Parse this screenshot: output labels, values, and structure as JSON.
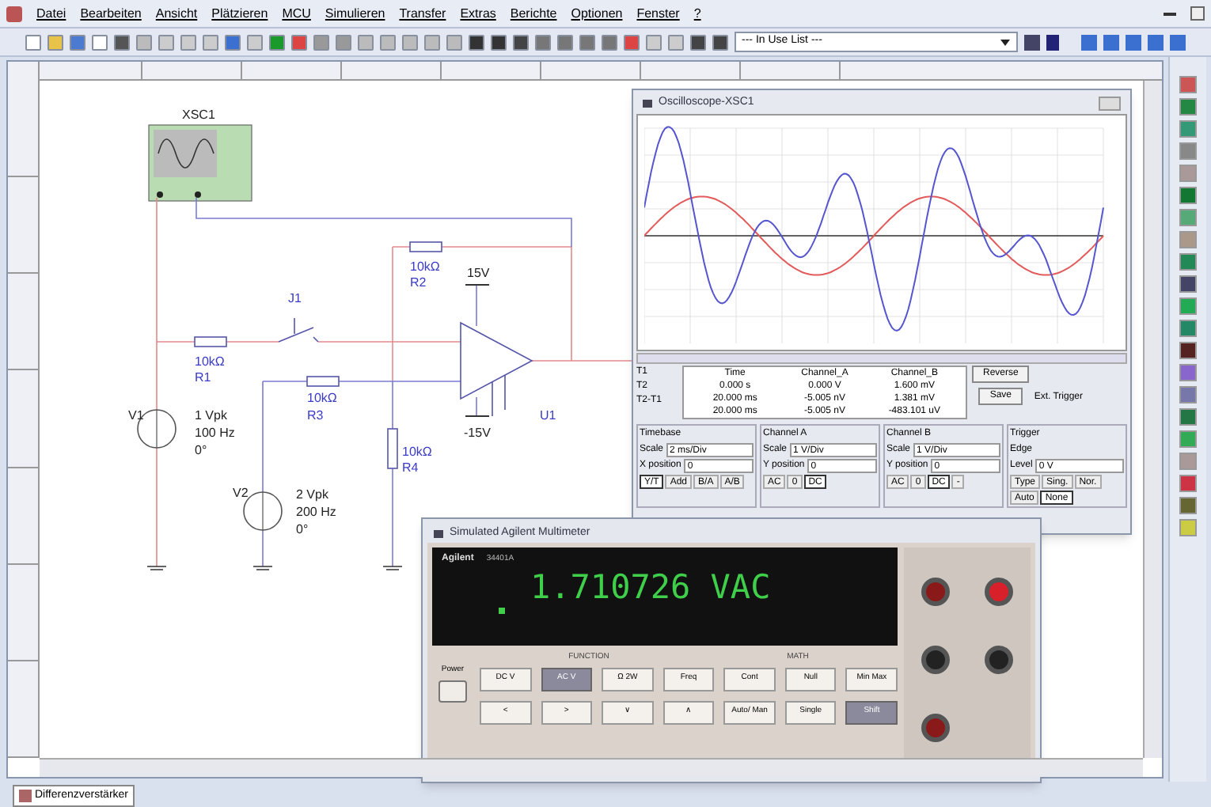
{
  "menu": [
    "Datei",
    "Bearbeiten",
    "Ansicht",
    "Plätzieren",
    "MCU",
    "Simulieren",
    "Transfer",
    "Extras",
    "Berichte",
    "Optionen",
    "Fenster",
    "?"
  ],
  "toolbar": {
    "in_use_list": "--- In Use List ---"
  },
  "schematic": {
    "labels": [
      {
        "text": "XSC1",
        "kind": "part"
      },
      {
        "text": "10kΩ",
        "kind": "ref"
      },
      {
        "text": "15V",
        "kind": "part"
      },
      {
        "text": "R2",
        "kind": "ref"
      },
      {
        "text": "J1",
        "kind": "ref"
      },
      {
        "text": "10kΩ",
        "kind": "ref"
      },
      {
        "text": "R1",
        "kind": "ref"
      },
      {
        "text": "10kΩ",
        "kind": "ref"
      },
      {
        "text": "V1",
        "kind": "part"
      },
      {
        "text": "1 Vpk",
        "kind": "part"
      },
      {
        "text": "R3",
        "kind": "ref"
      },
      {
        "text": "U1",
        "kind": "ref"
      },
      {
        "text": "100 Hz",
        "kind": "part"
      },
      {
        "text": "-15V",
        "kind": "part"
      },
      {
        "text": "0°",
        "kind": "part"
      },
      {
        "text": "10kΩ",
        "kind": "ref"
      },
      {
        "text": "R4",
        "kind": "ref"
      },
      {
        "text": "V2",
        "kind": "part"
      },
      {
        "text": "2 Vpk",
        "kind": "part"
      },
      {
        "text": "200 Hz",
        "kind": "part"
      },
      {
        "text": "0°",
        "kind": "part"
      }
    ]
  },
  "oscilloscope": {
    "title": "Oscilloscope-XSC1",
    "readout": {
      "columns": [
        "Time",
        "Channel_A",
        "Channel_B"
      ],
      "rows": [
        {
          "label": "T1",
          "values": [
            "0.000 s",
            "0.000 V",
            "1.600 mV"
          ]
        },
        {
          "label": "T2",
          "values": [
            "20.000 ms",
            "-5.005 nV",
            "1.381 mV"
          ]
        },
        {
          "label": "T2-T1",
          "values": [
            "20.000 ms",
            "-5.005 nV",
            "-483.101 uV"
          ]
        }
      ]
    },
    "buttons": [
      "Reverse",
      "Save"
    ],
    "ext_trigger": "Ext. Trigger",
    "sections": [
      {
        "title": "Timebase",
        "fields": [
          {
            "label": "Scale",
            "value": "2 ms/Div"
          },
          {
            "label": "X position",
            "value": "0"
          }
        ],
        "modes": [
          {
            "label": "Y/T",
            "selected": true
          },
          {
            "label": "Add",
            "selected": false
          },
          {
            "label": "B/A",
            "selected": false
          },
          {
            "label": "A/B",
            "selected": false
          }
        ]
      },
      {
        "title": "Channel A",
        "fields": [
          {
            "label": "Scale",
            "value": "1 V/Div"
          },
          {
            "label": "Y position",
            "value": "0"
          }
        ],
        "modes": [
          {
            "label": "AC",
            "selected": false
          },
          {
            "label": "0",
            "selected": false
          },
          {
            "label": "DC",
            "selected": true
          }
        ]
      },
      {
        "title": "Channel B",
        "fields": [
          {
            "label": "Scale",
            "value": "1 V/Div"
          },
          {
            "label": "Y position",
            "value": "0"
          }
        ],
        "modes": [
          {
            "label": "AC",
            "selected": false
          },
          {
            "label": "0",
            "selected": false
          },
          {
            "label": "DC",
            "selected": true
          },
          {
            "label": "-",
            "selected": false
          }
        ]
      },
      {
        "title": "Trigger",
        "fields": [
          {
            "label": "Edge"
          },
          {
            "label": "Level",
            "value": "0 V"
          }
        ],
        "modes": [
          {
            "label": "Type",
            "selected": false
          },
          {
            "label": "Sing.",
            "selected": false
          },
          {
            "label": "Nor.",
            "selected": false
          },
          {
            "label": "Auto",
            "selected": false
          },
          {
            "label": "None",
            "selected": true
          }
        ]
      }
    ]
  },
  "multimeter": {
    "title": "Simulated Agilent Multimeter",
    "brand": "Agilent",
    "model": "34401A",
    "reading": "1.710726 VAC",
    "power": "Power",
    "headers": [
      "FUNCTION",
      "MATH"
    ],
    "keys": [
      {
        "label": "DC V",
        "selected": false
      },
      {
        "label": "AC V",
        "selected": true
      },
      {
        "label": "Ω 2W",
        "selected": false
      },
      {
        "label": "Freq",
        "selected": false
      },
      {
        "label": "Cont",
        "selected": false
      },
      {
        "label": "Null",
        "selected": false
      },
      {
        "label": "Min Max",
        "selected": false
      },
      {
        "label": "<",
        "selected": false
      },
      {
        "label": ">",
        "selected": false
      },
      {
        "label": "∨",
        "selected": false
      },
      {
        "label": "∧",
        "selected": false
      },
      {
        "label": "Auto/ Man",
        "selected": false
      },
      {
        "label": "Single",
        "selected": false
      },
      {
        "label": "Shift",
        "selected": true
      }
    ]
  },
  "tabs": [
    {
      "label": "Differenzverstärker",
      "selected": true
    }
  ]
}
